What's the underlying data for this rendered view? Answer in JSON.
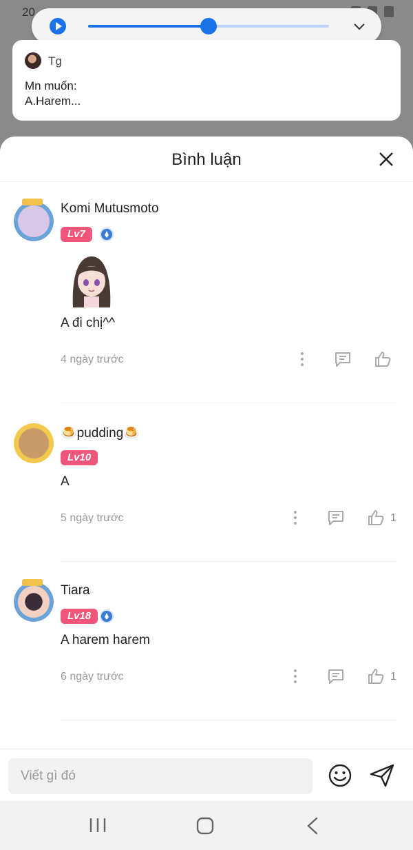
{
  "status_bar": {
    "time": "20"
  },
  "media": {
    "progress": 0.5
  },
  "notification": {
    "sender": "Tg",
    "line1": "Mn muốn:",
    "line2": "A.Harem..."
  },
  "sheet": {
    "title": "Bình luận"
  },
  "comments": [
    {
      "username": "Komi Mutusmoto",
      "level": "Lv7",
      "verified": true,
      "has_sticker": true,
      "text": "A đi chị^^",
      "time": "4 ngày trước",
      "likes": ""
    },
    {
      "username": "🍮pudding🍮",
      "level": "Lv10",
      "verified": false,
      "has_sticker": false,
      "text": "A",
      "time": "5 ngày trước",
      "likes": "1"
    },
    {
      "username": "Tiara",
      "level": "Lv18",
      "verified": true,
      "has_sticker": false,
      "text": "A harem harem",
      "time": "6 ngày trước",
      "likes": "1"
    }
  ],
  "input": {
    "placeholder": "Viết gì đó"
  },
  "colors": {
    "accent": "#1a73e8",
    "level_badge": "#f0567a",
    "verify": "#3a7bd5"
  }
}
